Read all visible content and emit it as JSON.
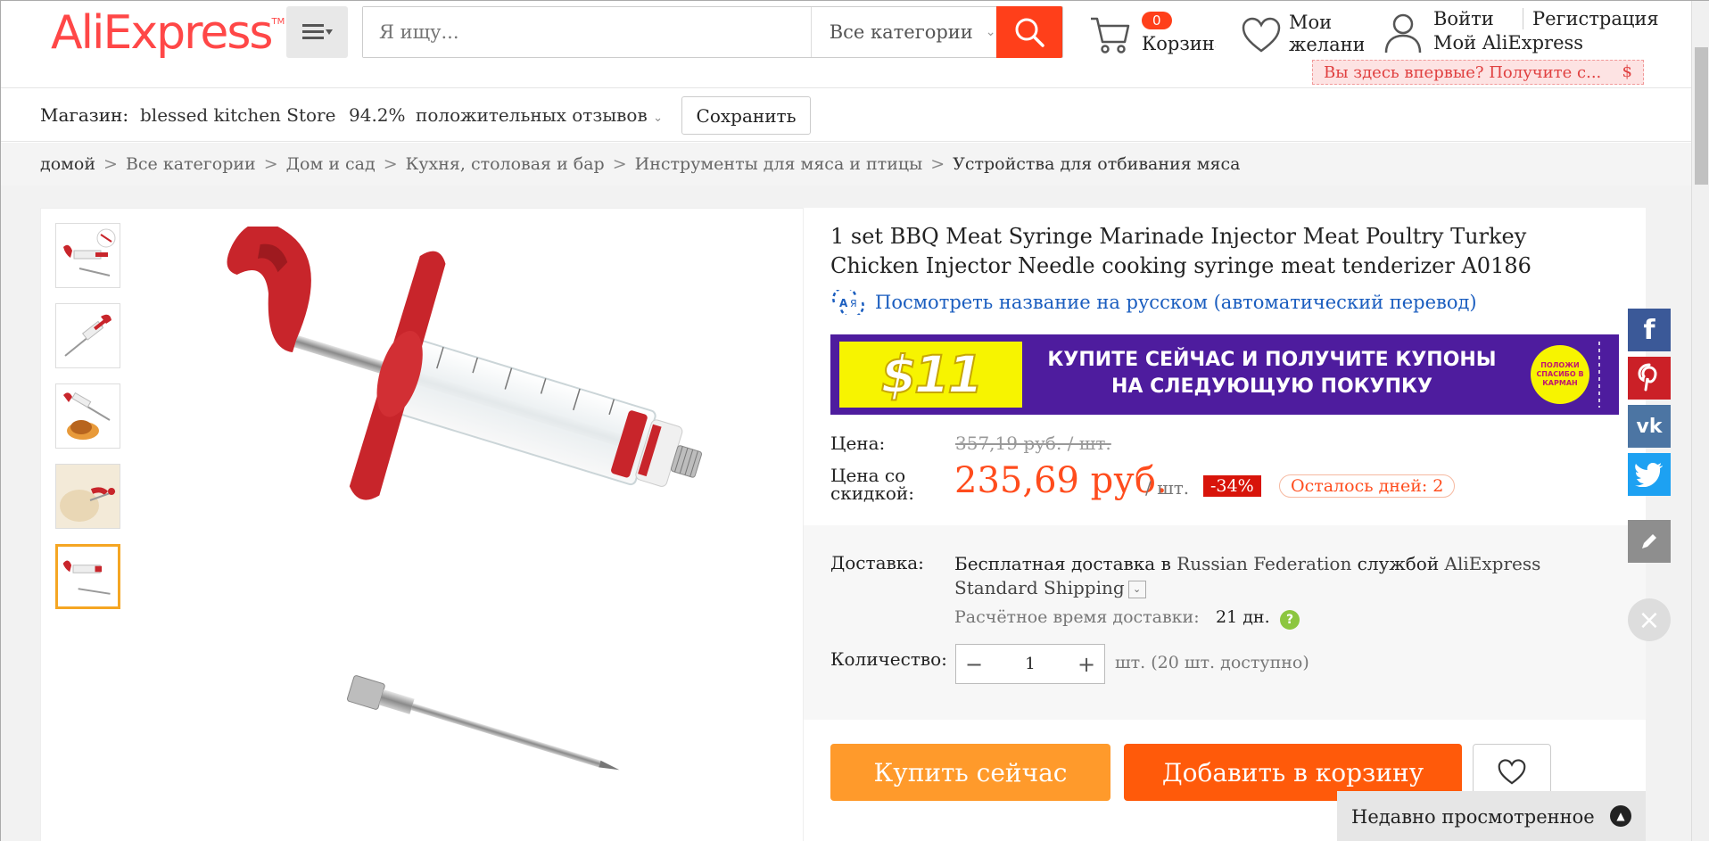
{
  "header": {
    "logo": "AliExpress",
    "logo_tm": "TM",
    "search_placeholder": "Я ищу...",
    "search_category": "Все категории",
    "cart_count": "0",
    "cart_label": "Корзина",
    "wishlist_label": "Мои желания",
    "login": "Войти",
    "register": "Регистрация",
    "my_account": "Мой AliExpress",
    "promo_text": "Вы здесь впервые? Получите с...",
    "promo_symbol": "$"
  },
  "store": {
    "label": "Магазин:",
    "name": "blessed kitchen Store",
    "feedback_pct": "94.2%",
    "feedback_label": "положительных отзывов",
    "save_label": "Сохранить"
  },
  "breadcrumb": [
    "домой",
    "Все категории",
    "Дом и сад",
    "Кухня, столовая и бар",
    "Инструменты для мяса и птицы",
    "Устройства для отбивания мяса"
  ],
  "breadcrumb_sep": ">",
  "product": {
    "title": "1 set BBQ Meat Syringe Marinade Injector Meat Poultry Turkey Chicken Injector Needle cooking syringe meat tenderizer A0186",
    "translate_link": "Посмотреть название на русском (автоматический перевод)",
    "banner_amount": "$11",
    "banner_line1": "КУПИТЕ СЕЙЧАС И ПОЛУЧИТЕ КУПОНЫ",
    "banner_line2": "НА СЛЕДУЮЩУЮ ПОКУПКУ",
    "banner_badge": "ПОЛОЖИ СПАСИБО В КАРМАН",
    "price_label": "Цена:",
    "old_price": "357,19 руб. / шт.",
    "discount_label": "Цена со скидкой:",
    "new_price": "235,69 руб.",
    "unit": "/ шт.",
    "discount_pct": "-34%",
    "days_left": "Осталось дней: 2",
    "shipping_label": "Доставка:",
    "shipping_prefix": "Бесплатная доставка в ",
    "shipping_country": "Russian Federation",
    "shipping_via": " службой ",
    "shipping_service": "AliExpress Standard Shipping",
    "eta_label": "Расчётное время доставки:",
    "eta_value": "21 дн.",
    "qty_label": "Количество:",
    "qty_value": "1",
    "qty_available": "шт. (20 шт. доступно)",
    "buy_now": "Купить сейчас",
    "add_to_cart": "Добавить в корзину"
  },
  "recently_viewed": "Недавно просмотренное",
  "social": [
    "facebook",
    "pinterest",
    "vk",
    "twitter",
    "edit"
  ],
  "colors": {
    "brand": "#ff4747",
    "accent": "#ff3f1a",
    "buy": "#ff9a2b",
    "cart": "#ff5a0a",
    "price": "#ff4c1d",
    "link": "#1a5dbf"
  }
}
